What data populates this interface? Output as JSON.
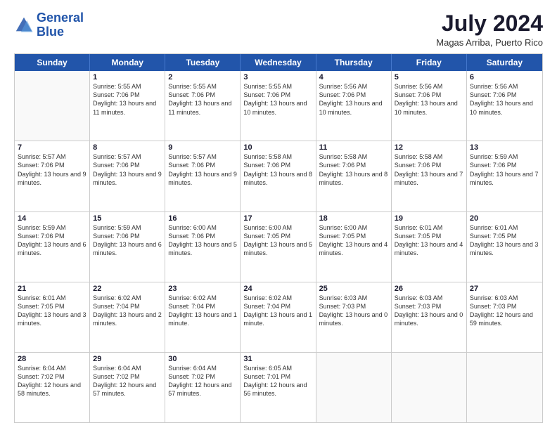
{
  "header": {
    "logo_line1": "General",
    "logo_line2": "Blue",
    "month": "July 2024",
    "location": "Magas Arriba, Puerto Rico"
  },
  "days": [
    "Sunday",
    "Monday",
    "Tuesday",
    "Wednesday",
    "Thursday",
    "Friday",
    "Saturday"
  ],
  "weeks": [
    [
      {
        "day": "",
        "sunrise": "",
        "sunset": "",
        "daylight": "",
        "empty": true
      },
      {
        "day": "1",
        "sunrise": "Sunrise: 5:55 AM",
        "sunset": "Sunset: 7:06 PM",
        "daylight": "Daylight: 13 hours and 11 minutes."
      },
      {
        "day": "2",
        "sunrise": "Sunrise: 5:55 AM",
        "sunset": "Sunset: 7:06 PM",
        "daylight": "Daylight: 13 hours and 11 minutes."
      },
      {
        "day": "3",
        "sunrise": "Sunrise: 5:55 AM",
        "sunset": "Sunset: 7:06 PM",
        "daylight": "Daylight: 13 hours and 10 minutes."
      },
      {
        "day": "4",
        "sunrise": "Sunrise: 5:56 AM",
        "sunset": "Sunset: 7:06 PM",
        "daylight": "Daylight: 13 hours and 10 minutes."
      },
      {
        "day": "5",
        "sunrise": "Sunrise: 5:56 AM",
        "sunset": "Sunset: 7:06 PM",
        "daylight": "Daylight: 13 hours and 10 minutes."
      },
      {
        "day": "6",
        "sunrise": "Sunrise: 5:56 AM",
        "sunset": "Sunset: 7:06 PM",
        "daylight": "Daylight: 13 hours and 10 minutes."
      }
    ],
    [
      {
        "day": "7",
        "sunrise": "Sunrise: 5:57 AM",
        "sunset": "Sunset: 7:06 PM",
        "daylight": "Daylight: 13 hours and 9 minutes."
      },
      {
        "day": "8",
        "sunrise": "Sunrise: 5:57 AM",
        "sunset": "Sunset: 7:06 PM",
        "daylight": "Daylight: 13 hours and 9 minutes."
      },
      {
        "day": "9",
        "sunrise": "Sunrise: 5:57 AM",
        "sunset": "Sunset: 7:06 PM",
        "daylight": "Daylight: 13 hours and 9 minutes."
      },
      {
        "day": "10",
        "sunrise": "Sunrise: 5:58 AM",
        "sunset": "Sunset: 7:06 PM",
        "daylight": "Daylight: 13 hours and 8 minutes."
      },
      {
        "day": "11",
        "sunrise": "Sunrise: 5:58 AM",
        "sunset": "Sunset: 7:06 PM",
        "daylight": "Daylight: 13 hours and 8 minutes."
      },
      {
        "day": "12",
        "sunrise": "Sunrise: 5:58 AM",
        "sunset": "Sunset: 7:06 PM",
        "daylight": "Daylight: 13 hours and 7 minutes."
      },
      {
        "day": "13",
        "sunrise": "Sunrise: 5:59 AM",
        "sunset": "Sunset: 7:06 PM",
        "daylight": "Daylight: 13 hours and 7 minutes."
      }
    ],
    [
      {
        "day": "14",
        "sunrise": "Sunrise: 5:59 AM",
        "sunset": "Sunset: 7:06 PM",
        "daylight": "Daylight: 13 hours and 6 minutes."
      },
      {
        "day": "15",
        "sunrise": "Sunrise: 5:59 AM",
        "sunset": "Sunset: 7:06 PM",
        "daylight": "Daylight: 13 hours and 6 minutes."
      },
      {
        "day": "16",
        "sunrise": "Sunrise: 6:00 AM",
        "sunset": "Sunset: 7:06 PM",
        "daylight": "Daylight: 13 hours and 5 minutes."
      },
      {
        "day": "17",
        "sunrise": "Sunrise: 6:00 AM",
        "sunset": "Sunset: 7:05 PM",
        "daylight": "Daylight: 13 hours and 5 minutes."
      },
      {
        "day": "18",
        "sunrise": "Sunrise: 6:00 AM",
        "sunset": "Sunset: 7:05 PM",
        "daylight": "Daylight: 13 hours and 4 minutes."
      },
      {
        "day": "19",
        "sunrise": "Sunrise: 6:01 AM",
        "sunset": "Sunset: 7:05 PM",
        "daylight": "Daylight: 13 hours and 4 minutes."
      },
      {
        "day": "20",
        "sunrise": "Sunrise: 6:01 AM",
        "sunset": "Sunset: 7:05 PM",
        "daylight": "Daylight: 13 hours and 3 minutes."
      }
    ],
    [
      {
        "day": "21",
        "sunrise": "Sunrise: 6:01 AM",
        "sunset": "Sunset: 7:05 PM",
        "daylight": "Daylight: 13 hours and 3 minutes."
      },
      {
        "day": "22",
        "sunrise": "Sunrise: 6:02 AM",
        "sunset": "Sunset: 7:04 PM",
        "daylight": "Daylight: 13 hours and 2 minutes."
      },
      {
        "day": "23",
        "sunrise": "Sunrise: 6:02 AM",
        "sunset": "Sunset: 7:04 PM",
        "daylight": "Daylight: 13 hours and 1 minute."
      },
      {
        "day": "24",
        "sunrise": "Sunrise: 6:02 AM",
        "sunset": "Sunset: 7:04 PM",
        "daylight": "Daylight: 13 hours and 1 minute."
      },
      {
        "day": "25",
        "sunrise": "Sunrise: 6:03 AM",
        "sunset": "Sunset: 7:03 PM",
        "daylight": "Daylight: 13 hours and 0 minutes."
      },
      {
        "day": "26",
        "sunrise": "Sunrise: 6:03 AM",
        "sunset": "Sunset: 7:03 PM",
        "daylight": "Daylight: 13 hours and 0 minutes."
      },
      {
        "day": "27",
        "sunrise": "Sunrise: 6:03 AM",
        "sunset": "Sunset: 7:03 PM",
        "daylight": "Daylight: 12 hours and 59 minutes."
      }
    ],
    [
      {
        "day": "28",
        "sunrise": "Sunrise: 6:04 AM",
        "sunset": "Sunset: 7:02 PM",
        "daylight": "Daylight: 12 hours and 58 minutes."
      },
      {
        "day": "29",
        "sunrise": "Sunrise: 6:04 AM",
        "sunset": "Sunset: 7:02 PM",
        "daylight": "Daylight: 12 hours and 57 minutes."
      },
      {
        "day": "30",
        "sunrise": "Sunrise: 6:04 AM",
        "sunset": "Sunset: 7:02 PM",
        "daylight": "Daylight: 12 hours and 57 minutes."
      },
      {
        "day": "31",
        "sunrise": "Sunrise: 6:05 AM",
        "sunset": "Sunset: 7:01 PM",
        "daylight": "Daylight: 12 hours and 56 minutes."
      },
      {
        "day": "",
        "sunrise": "",
        "sunset": "",
        "daylight": "",
        "empty": true
      },
      {
        "day": "",
        "sunrise": "",
        "sunset": "",
        "daylight": "",
        "empty": true
      },
      {
        "day": "",
        "sunrise": "",
        "sunset": "",
        "daylight": "",
        "empty": true
      }
    ]
  ]
}
